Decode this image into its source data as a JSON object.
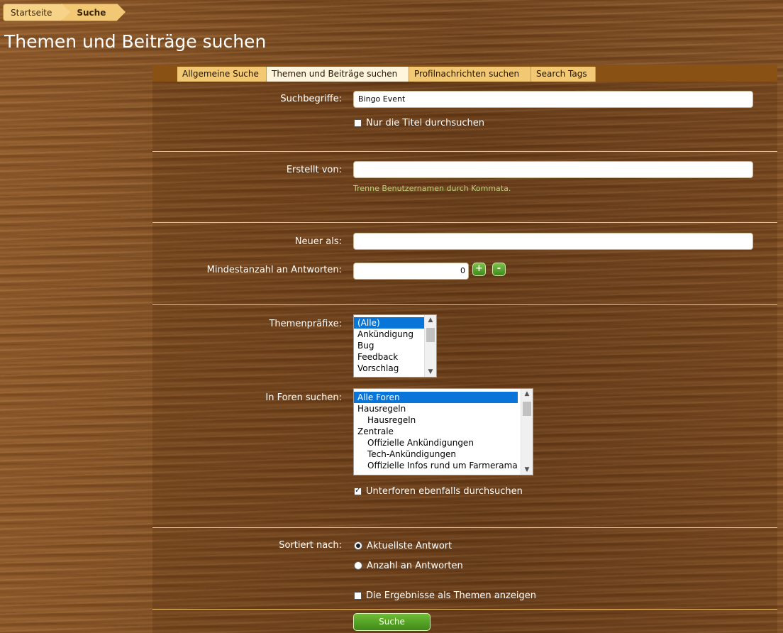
{
  "breadcrumb": {
    "home": "Startseite",
    "current": "Suche"
  },
  "page_title": "Themen und Beiträge suchen",
  "tabs": [
    {
      "label": "Allgemeine Suche"
    },
    {
      "label": "Themen und Beiträge suchen",
      "active": true
    },
    {
      "label": "Profilnachrichten suchen"
    },
    {
      "label": "Search Tags"
    }
  ],
  "form": {
    "keywords": {
      "label": "Suchbegriffe:",
      "value": "Bingo Event"
    },
    "titles_only": {
      "label": "Nur die Titel durchsuchen",
      "checked": false
    },
    "created_by": {
      "label": "Erstellt von:",
      "value": "",
      "hint": "Trenne Benutzernamen durch Kommata."
    },
    "newer_than": {
      "label": "Neuer als:",
      "value": ""
    },
    "min_replies": {
      "label": "Mindestanzahl an Antworten:",
      "value": "0",
      "plus": "+",
      "minus": "-"
    },
    "prefixes": {
      "label": "Themenpräfixe:",
      "options": [
        "(Alle)",
        "Ankündigung",
        "Bug",
        "Feedback",
        "Vorschlag"
      ],
      "selected": "(Alle)"
    },
    "forums": {
      "label": "In Foren suchen:",
      "options": [
        "Alle Foren",
        "Hausregeln",
        "Hausregeln",
        "Zentrale",
        "Offizielle Ankündigungen",
        "Tech-Ankündigungen",
        "Offizielle Infos rund um Farmerama"
      ],
      "selected": "Alle Foren"
    },
    "include_subforums": {
      "label": "Unterforen ebenfalls durchsuchen",
      "checked": true
    },
    "sort_by": {
      "label": "Sortiert nach:",
      "options": [
        "Aktuellste Antwort",
        "Anzahl an Antworten"
      ],
      "selected": "Aktuellste Antwort"
    },
    "show_as_threads": {
      "label": "Die Ergebnisse als Themen anzeigen",
      "checked": false
    },
    "submit": "Suche"
  },
  "colors": {
    "wood": "#7a4a20",
    "tab": "#f2c874",
    "tab_active": "#fff4dc",
    "divider": "#f0c070",
    "button_green": "#4f9d22",
    "hint_green": "#b9d27a",
    "selection_blue": "#0a75d8"
  }
}
